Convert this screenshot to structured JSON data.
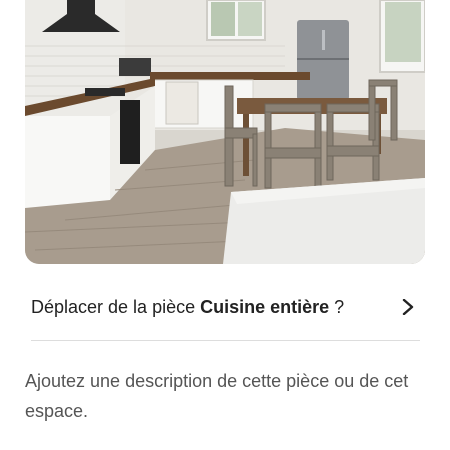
{
  "photo": {
    "alt": "Kitchen with dining table"
  },
  "room_move": {
    "prefix": "Déplacer de la pièce ",
    "room_name": "Cuisine entière",
    "suffix": " ?",
    "icon": "chevron-right-icon"
  },
  "description": {
    "placeholder": "Ajoutez une description de cette pièce ou de cet espace."
  }
}
